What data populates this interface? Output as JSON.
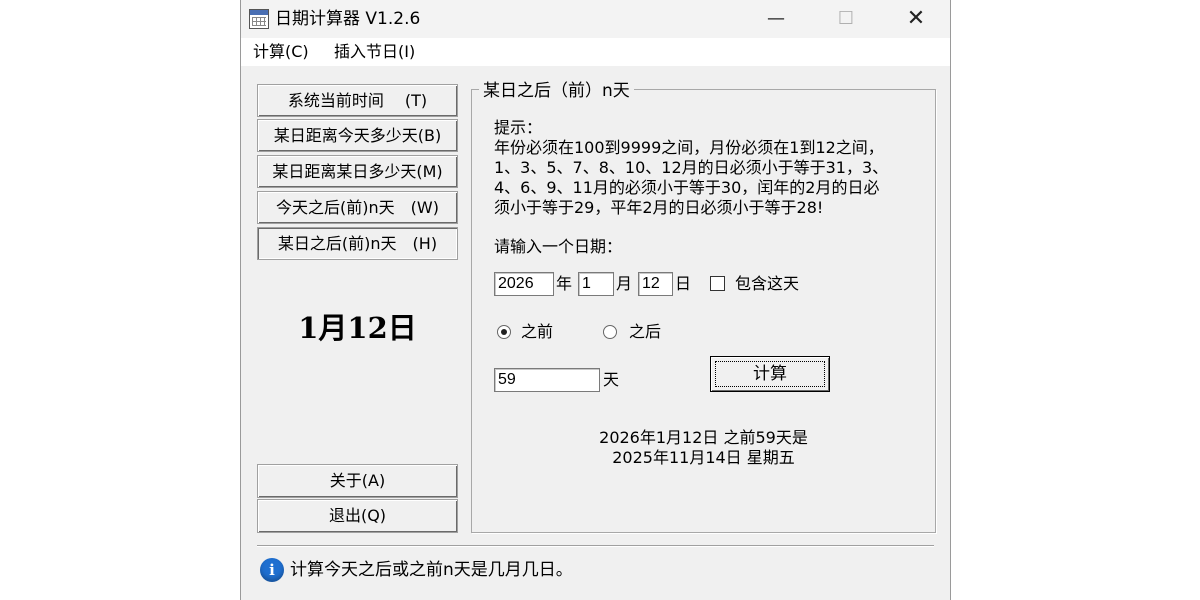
{
  "window": {
    "title": "日期计算器  V1.2.6",
    "minimize_glyph": "—",
    "maximize_glyph": "☐",
    "close_glyph": "✕"
  },
  "menu": [
    {
      "label": "计算(C)"
    },
    {
      "label": "插入节日(I)"
    }
  ],
  "nav": {
    "buttons": [
      {
        "label": "系统当前时间　 (T)"
      },
      {
        "label": "某日距离今天多少天(B)"
      },
      {
        "label": "某日距离某日多少天(M)"
      },
      {
        "label": "今天之后(前)n天　(W)"
      },
      {
        "label": "某日之后(前)n天　(H)",
        "active": true
      }
    ],
    "today": "1月12日",
    "about": "关于(A)",
    "exit": "退出(Q)"
  },
  "panel": {
    "title": "某日之后（前）n天",
    "hint_title": "提示：",
    "hint_lines": [
      "年份必须在100到9999之间，月份必须在1到12之间，",
      "1、3、5、7、8、10、12月的日必须小于等于31，3、",
      "4、6、9、11月的必须小于等于30，闰年的2月的日必",
      "须小于等于29，平年2月的日必须小于等于28!"
    ],
    "prompt": "请输入一个日期：",
    "year": "2026",
    "year_unit": "年",
    "month": "1",
    "month_unit": "月",
    "day": "12",
    "day_unit": "日",
    "include_today": "包含这天",
    "include_today_checked": false,
    "before_label": "之前",
    "after_label": "之后",
    "direction": "before",
    "days": "59",
    "days_unit": "天",
    "calc_button": "计算",
    "result_line1": "2026年1月12日  之前59天是",
    "result_line2": "2025年11月14日  星期五"
  },
  "status": {
    "icon": "info-icon",
    "icon_glyph": "i",
    "text": "计算今天之后或之前n天是几月几日。"
  }
}
